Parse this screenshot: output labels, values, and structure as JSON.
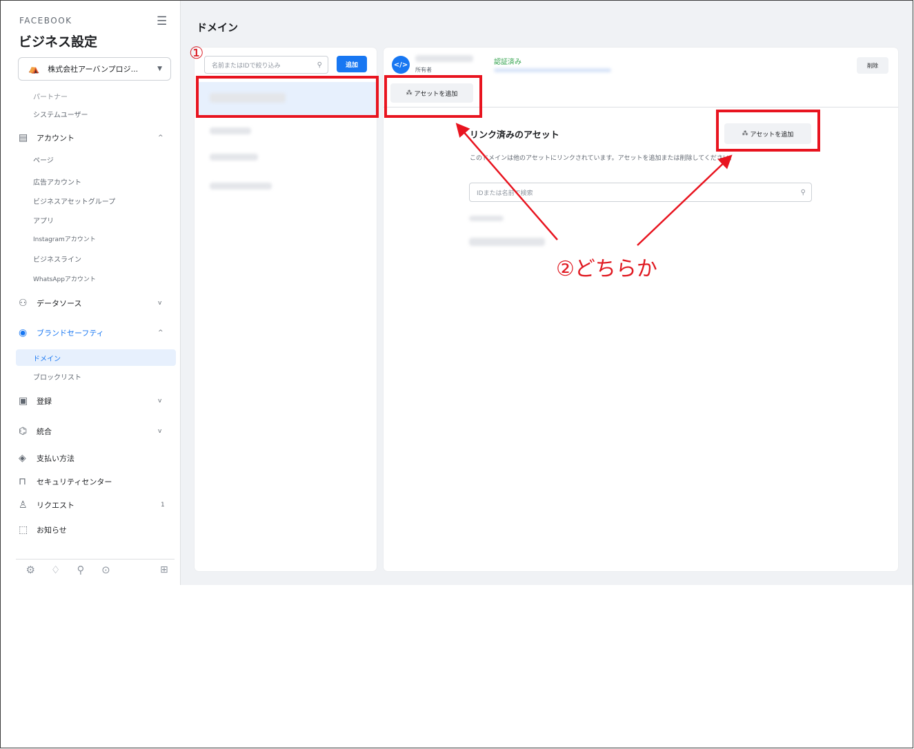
{
  "sidebar": {
    "brand": "FACEBOOK",
    "title": "ビジネス設定",
    "business_name": "株式会社アーバンプロジ...",
    "top_items": [
      "パートナー",
      "システムユーザー"
    ],
    "sections": [
      {
        "label": "アカウント",
        "icon": "account-icon",
        "expanded": true
      },
      {
        "label": "データソース",
        "icon": "data-source-icon",
        "expanded": false
      },
      {
        "label": "ブランドセーフティ",
        "icon": "brand-safety-icon",
        "expanded": true
      },
      {
        "label": "登録",
        "icon": "clipboard-icon",
        "expanded": false
      },
      {
        "label": "統合",
        "icon": "integration-icon",
        "expanded": false
      }
    ],
    "account_items": [
      "ページ",
      "広告アカウント",
      "ビジネスアセットグループ",
      "アプリ",
      "Instagramアカウント",
      "ビジネスライン",
      "WhatsAppアカウント"
    ],
    "brand_safety_items": [
      "ドメイン",
      "ブロックリスト"
    ],
    "other_items": [
      "支払い方法",
      "セキュリティセンター",
      "リクエスト",
      "お知らせ"
    ],
    "request_count": "1",
    "active_item": "ドメイン"
  },
  "main": {
    "page_title": "ドメイン",
    "list": {
      "search_placeholder": "名前またはIDで絞り込み",
      "add_label": "追加"
    },
    "detail": {
      "domain_icon": "</>",
      "owner_label": "所有者",
      "status": "認証済み",
      "delete_label": "削除",
      "add_asset_label": "アセットを追加",
      "linked_title": "リンク済みのアセット",
      "linked_add_label": "アセットを追加",
      "linked_desc": "このドメインは他のアセットにリンクされています。アセットを追加または削除してください。",
      "search_placeholder": "IDまたは名前で検索"
    }
  },
  "annotations": {
    "step1": "①",
    "step2": "②どちらか",
    "color": "#e8141f"
  }
}
